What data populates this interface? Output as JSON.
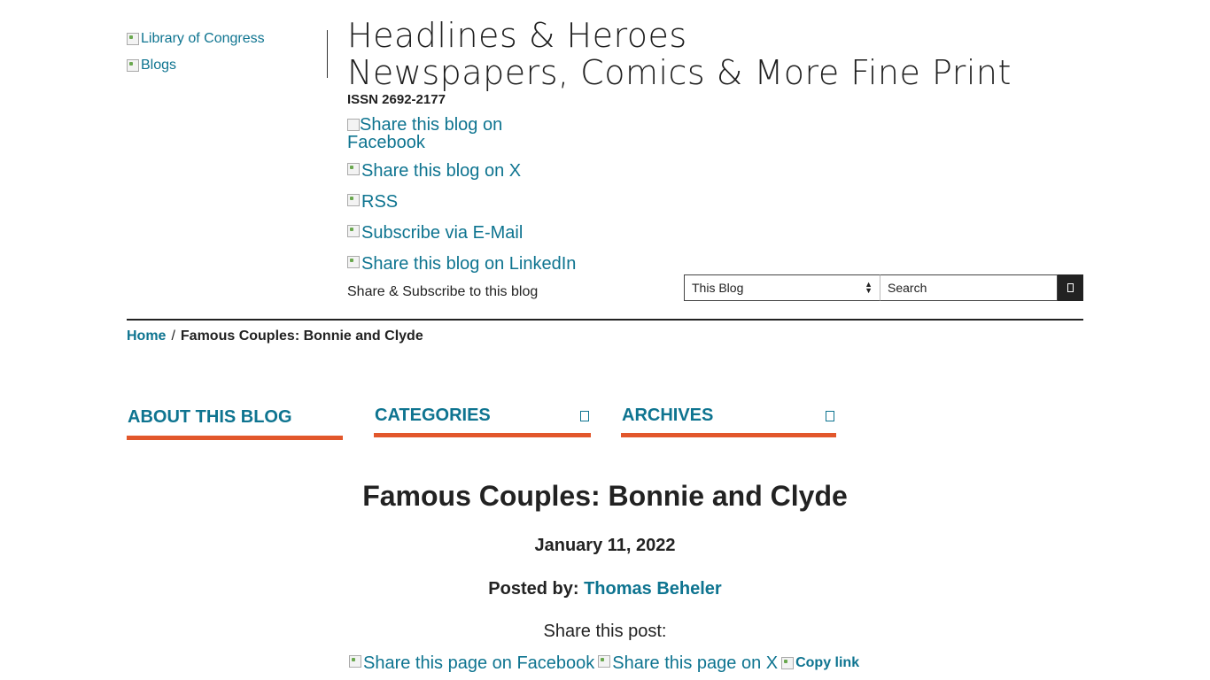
{
  "header": {
    "loc_logo_alt": "Library of Congress",
    "blogs_logo_alt": "Blogs",
    "title_line1": "Headlines & Heroes",
    "title_line2": "Newspapers, Comics & More Fine Print",
    "issn": "ISSN 2692-2177"
  },
  "share_blog": {
    "facebook": "Share this blog on Facebook",
    "x": "Share this blog on X",
    "rss": "RSS",
    "email": "Subscribe via E-Mail",
    "linkedin": "Share this blog on LinkedIn",
    "caption": "Share & Subscribe to this blog"
  },
  "search": {
    "scope_selected": "This Blog",
    "placeholder": "Search"
  },
  "breadcrumb": {
    "home": "Home",
    "separator": "/",
    "current": "Famous Couples: Bonnie and Clyde"
  },
  "tabs": [
    {
      "label": "ABOUT THIS BLOG"
    },
    {
      "label": "CATEGORIES"
    },
    {
      "label": "ARCHIVES"
    }
  ],
  "post": {
    "title": "Famous Couples: Bonnie and Clyde",
    "date": "January 11, 2022",
    "posted_by_label": "Posted by:",
    "author": "Thomas Beheler",
    "share_label": "Share this post:",
    "share_facebook": "Share this page on Facebook",
    "share_x": "Share this page on X",
    "copy_link": "Copy link"
  },
  "colors": {
    "link": "#0e7490",
    "accent_underline": "#e2572b",
    "text": "#222222"
  }
}
